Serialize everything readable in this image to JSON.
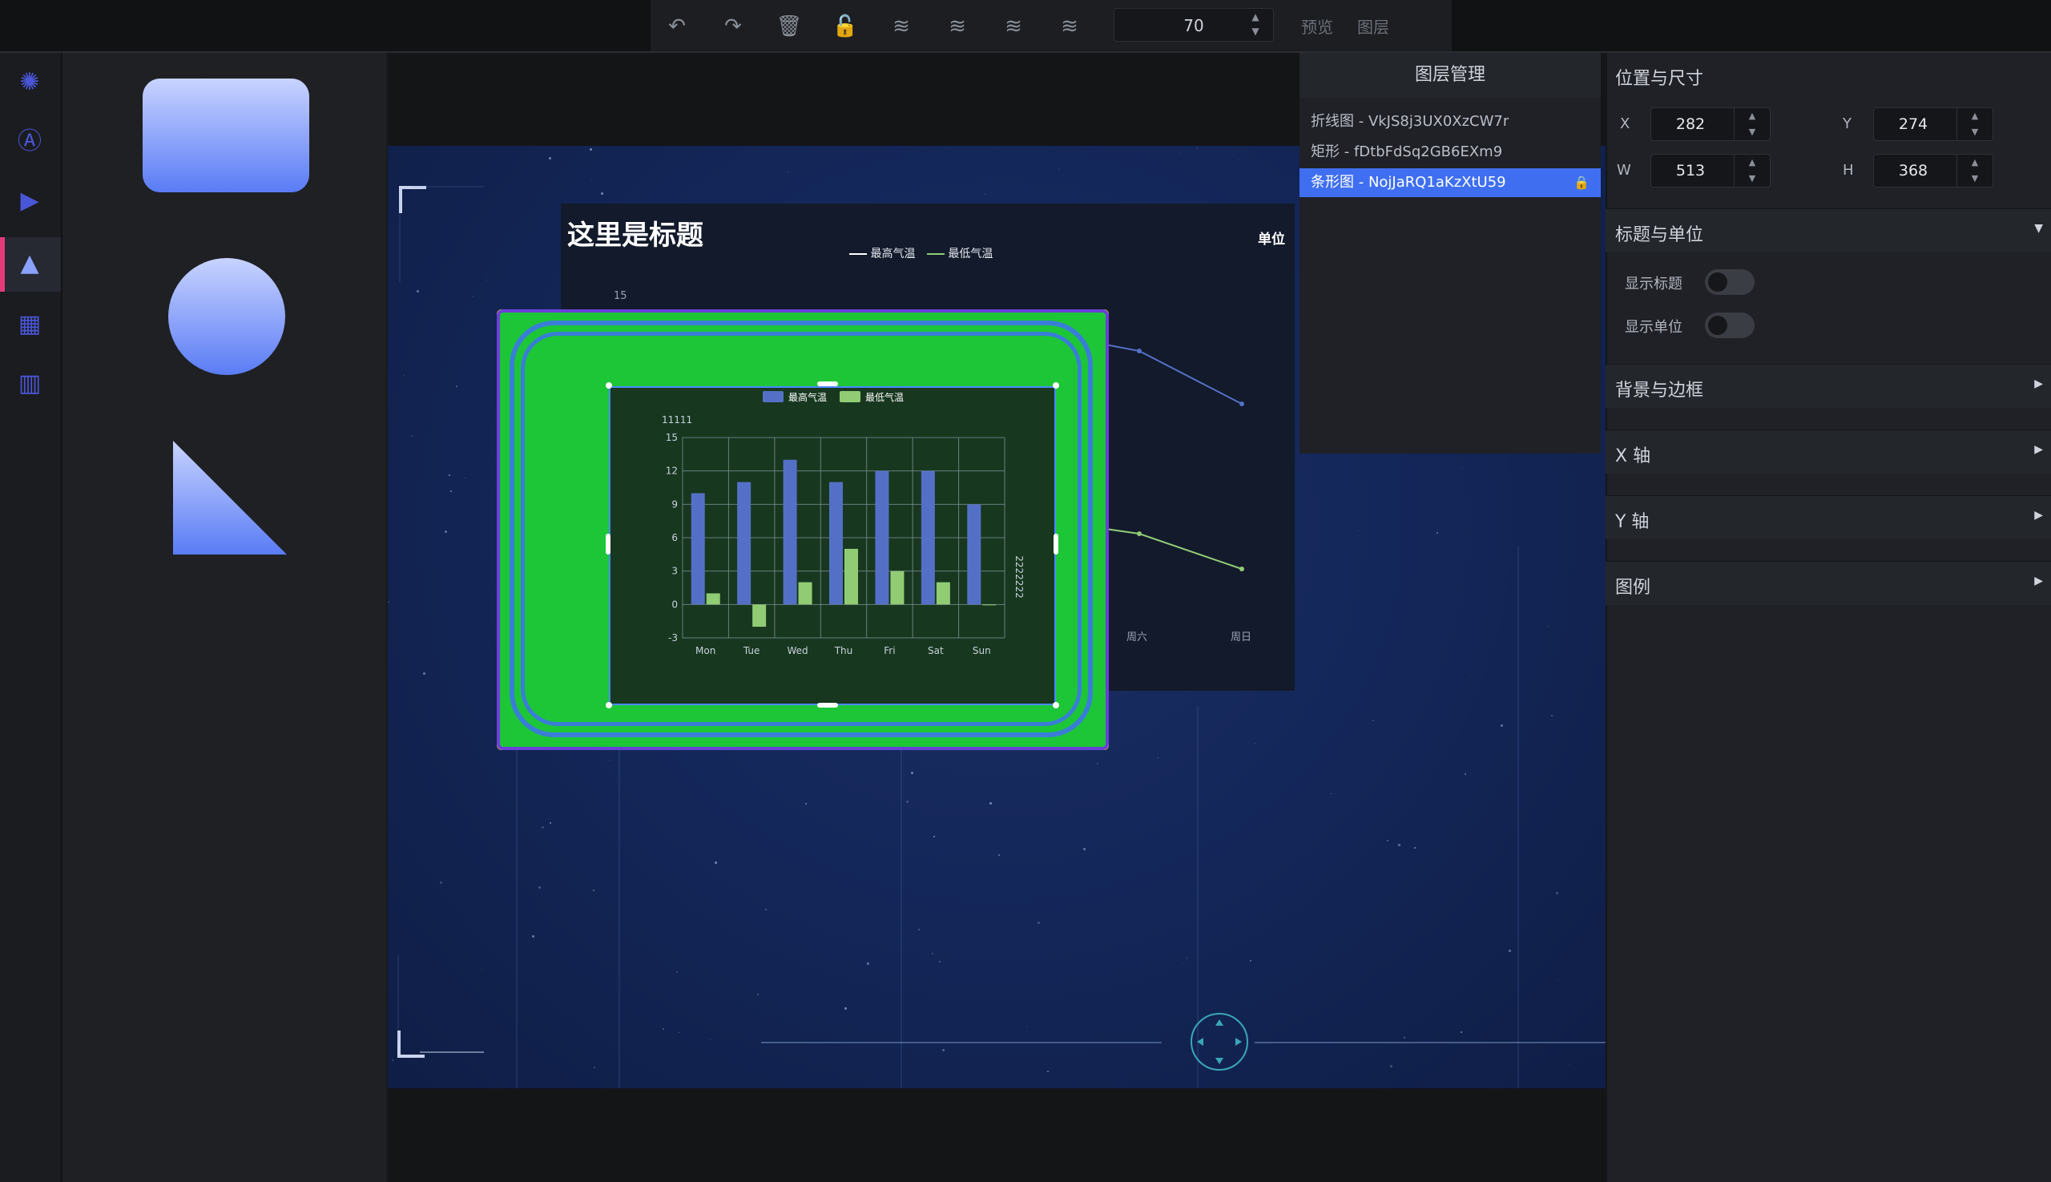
{
  "toolbar": {
    "zoom_value": "70",
    "preview_label": "预览",
    "layers_label": "图层",
    "icons": [
      "undo-icon",
      "redo-icon",
      "delete-icon",
      "unlock-icon",
      "layer-down-icon",
      "layer-up-icon",
      "layer-top-icon",
      "layer-bottom-icon"
    ]
  },
  "sidebar": {
    "icons": [
      "chart-icon",
      "text-icon",
      "media-icon",
      "shape-icon",
      "widget-icon",
      "map-icon"
    ],
    "active_index": 3
  },
  "shapes": [
    "rounded-rectangle",
    "circle",
    "triangle"
  ],
  "canvas": {
    "line_chart": {
      "title": "这里是标题",
      "unit": "单位",
      "legend": [
        "最高气温",
        "最低气温"
      ],
      "y_top_tick": "15",
      "x_ticks_visible": [
        "周六",
        "周日"
      ]
    },
    "bar_chart": {
      "legend": [
        "最高气温",
        "最低气温"
      ],
      "y_axis_name": "11111",
      "right_axis_name": "2222222",
      "chart_data": {
        "type": "bar",
        "categories": [
          "Mon",
          "Tue",
          "Wed",
          "Thu",
          "Fri",
          "Sat",
          "Sun"
        ],
        "series": [
          {
            "name": "最高气温",
            "values": [
              10,
              11,
              13,
              11,
              12,
              12,
              9
            ]
          },
          {
            "name": "最低气温",
            "values": [
              1,
              -2,
              2,
              5,
              3,
              2,
              0
            ]
          }
        ],
        "y_ticks": [
          "15",
          "12",
          "9",
          "6",
          "3",
          "0",
          "-3"
        ],
        "ylim": [
          -3,
          15
        ],
        "grid": true,
        "colors": [
          "#5470c6",
          "#91cc75"
        ]
      }
    }
  },
  "layers": {
    "title": "图层管理",
    "items": [
      {
        "label": "折线图 - VkJS8j3UX0XzCW7r",
        "selected": false
      },
      {
        "label": "矩形 - fDtbFdSq2GB6EXm9",
        "selected": false
      },
      {
        "label": "条形图 - NojJaRQ1aKzXtU59",
        "selected": true
      }
    ]
  },
  "properties": {
    "title": "位置与尺寸",
    "x_label": "X",
    "x_value": "282",
    "y_label": "Y",
    "y_value": "274",
    "w_label": "W",
    "w_value": "513",
    "h_label": "H",
    "h_value": "368",
    "sections": {
      "title_unit": "标题与单位",
      "show_title": "显示标题",
      "show_unit": "显示单位",
      "background_border": "背景与边框",
      "x_axis": "X 轴",
      "y_axis": "Y 轴",
      "legend": "图例"
    }
  }
}
